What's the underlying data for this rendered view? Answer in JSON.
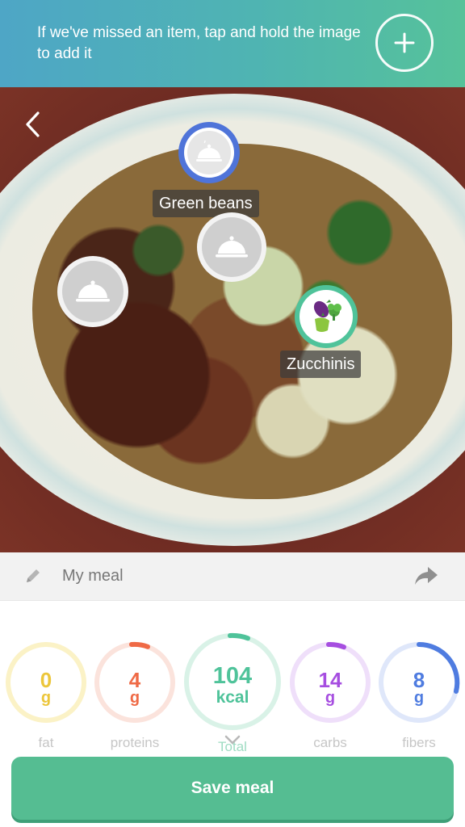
{
  "banner": {
    "hint_text": "If we've missed an item, tap and hold the image to add it",
    "add_icon": "plus-icon"
  },
  "photo": {
    "back_icon": "chevron-left-icon",
    "markers": [
      {
        "label": "Green beans",
        "icon": "cloche-icon",
        "selected": true
      },
      {
        "label": "",
        "icon": "cloche-icon",
        "selected": false
      },
      {
        "label": "",
        "icon": "cloche-icon",
        "selected": false
      },
      {
        "label": "Zucchinis",
        "icon": "vegetables-icon",
        "selected": false
      }
    ]
  },
  "meal": {
    "name": "My meal",
    "edit_icon": "pencil-icon",
    "share_icon": "share-icon"
  },
  "nutrition": {
    "fat": {
      "value": "0",
      "unit": "g",
      "label": "fat",
      "color": "#f1d24a",
      "progress": 0
    },
    "proteins": {
      "value": "4",
      "unit": "g",
      "label": "proteins",
      "color": "#ef6a46",
      "progress": 0.04
    },
    "total": {
      "value": "104",
      "unit": "kcal",
      "label": "Total",
      "color": "#4fc39a",
      "progress": 0.05
    },
    "carbs": {
      "value": "14",
      "unit": "g",
      "label": "carbs",
      "color": "#a64ee0",
      "progress": 0.06
    },
    "fibers": {
      "value": "8",
      "unit": "g",
      "label": "fibers",
      "color": "#4f7ce0",
      "progress": 0.32
    }
  },
  "save_label": "Save meal",
  "colors": {
    "accent": "#55bd92",
    "banner_start": "#4ea6c6",
    "banner_end": "#56c29a",
    "selected_marker": "#4f74d9"
  }
}
